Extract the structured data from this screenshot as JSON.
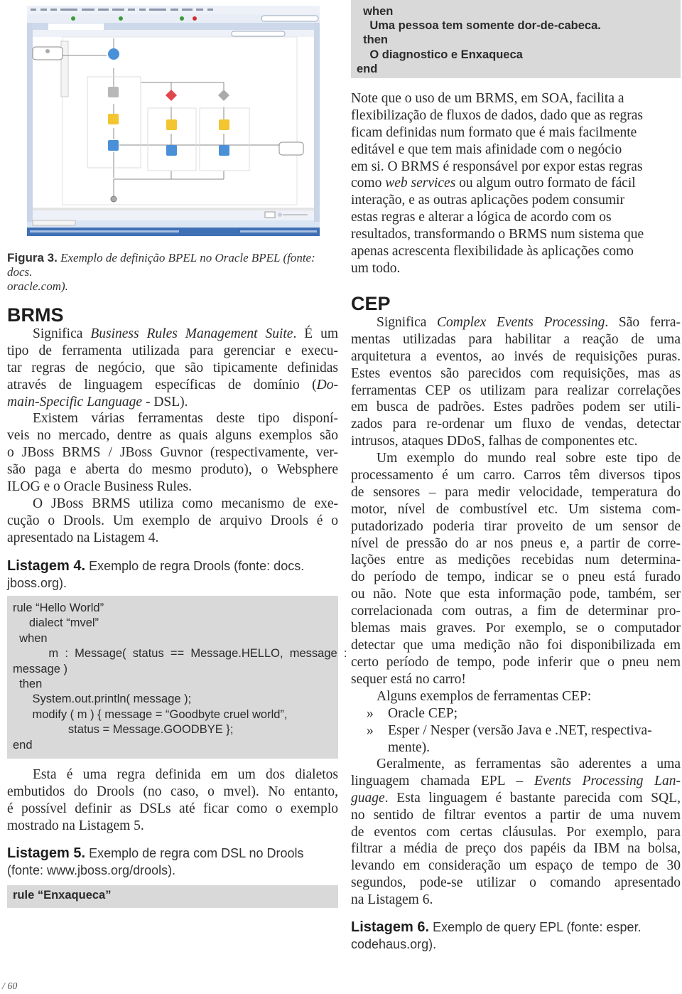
{
  "figure": {
    "caption_label": "Figura 3.",
    "caption_lines": [
      "Exemplo de definição BPEL no Oracle BPEL (fonte: docs.",
      "oracle.com)."
    ]
  },
  "left": {
    "brms_heading": "BRMS",
    "paragraphs": [
      {
        "indent": true,
        "lines": [
          [
            {
              "t": "Significa "
            },
            {
              "t": "Business Rules Management Suite",
              "it": true
            },
            {
              "t": ". É um"
            }
          ],
          [
            {
              "t": "tipo de ferramenta utilizada para gerenciar e execu-"
            }
          ],
          [
            {
              "t": "tar regras de negócio, que são tipicamente definidas"
            }
          ],
          [
            {
              "t": "através de linguagem específicas de domínio ("
            },
            {
              "t": "Do-",
              "it": true
            }
          ],
          [
            {
              "t": "main-Specific Language",
              "it": true
            },
            {
              "t": " - DSL)."
            }
          ]
        ]
      },
      {
        "indent": true,
        "lines": [
          [
            {
              "t": "Existem várias ferramentas deste tipo disponí-"
            }
          ],
          [
            {
              "t": "veis no mercado, dentre as quais alguns exemplos são"
            }
          ],
          [
            {
              "t": "o JBoss BRMS / JBoss Guvnor (respectivamente, ver-"
            }
          ],
          [
            {
              "t": "são paga e aberta do mesmo produto), o Websphere"
            }
          ],
          [
            {
              "t": "ILOG e o Oracle Business Rules."
            }
          ]
        ]
      },
      {
        "indent": true,
        "lines": [
          [
            {
              "t": "O JBoss BRMS utiliza como mecanismo de exe-"
            }
          ],
          [
            {
              "t": "cução o Drools. Um exemplo de arquivo Drools é o"
            }
          ],
          [
            {
              "t": "apresentado na Listagem 4."
            }
          ]
        ]
      }
    ],
    "listing4": {
      "label": "Listagem 4.",
      "caption_lines": [
        "Exemplo de regra Drools (fonte: docs.",
        "jboss.org)."
      ],
      "code": [
        "rule “Hello World”",
        "     dialect “mvel”",
        "  when",
        "           m  :  Message(  status  ==  Message.HELLO,  message  :",
        "message )",
        "  then",
        "      System.out.println( message );",
        "      modify ( m ) { message = “Goodbyte cruel world”,",
        "                 status = Message.GOODBYE };",
        "end"
      ]
    },
    "paragraph_after": {
      "indent": true,
      "lines": [
        [
          {
            "t": "Esta é uma regra definida em um dos dialetos"
          }
        ],
        [
          {
            "t": "embutidos do Drools (no caso, o mvel). No entanto,"
          }
        ],
        [
          {
            "t": "é possível definir as DSLs até ficar como o exemplo"
          }
        ],
        [
          {
            "t": "mostrado na Listagem 5."
          }
        ]
      ]
    },
    "listing5": {
      "label": "Listagem 5.",
      "caption_lines": [
        "Exemplo de regra com DSL no Drools",
        "(fonte: www.jboss.org/drools)."
      ],
      "code": [
        "rule “Enxaqueca”"
      ]
    }
  },
  "right": {
    "code_top": [
      "  when",
      "    Uma pessoa tem somente dor-de-cabeca.",
      "  then",
      "    O diagnostico e Enxaqueca",
      "end"
    ],
    "note_paragraph": {
      "indent": false,
      "ragged": true,
      "lines": [
        [
          {
            "t": "Note que o uso de um BRMS, em SOA, facilita a"
          }
        ],
        [
          {
            "t": "flexibilização de fluxos de dados, dado que as regras"
          }
        ],
        [
          {
            "t": "ficam definidas num formato que é mais facilmente"
          }
        ],
        [
          {
            "t": "editável e que tem mais afinidade com o negócio"
          }
        ],
        [
          {
            "t": "em si. O BRMS é responsável por expor estas regras"
          }
        ],
        [
          {
            "t": "como "
          },
          {
            "t": "web services",
            "it": true
          },
          {
            "t": " ou algum outro formato de fácil"
          }
        ],
        [
          {
            "t": "interação, e as outras aplicações podem consumir"
          }
        ],
        [
          {
            "t": "estas regras e alterar a lógica de acordo com os"
          }
        ],
        [
          {
            "t": "resultados, transformando o BRMS num sistema que"
          }
        ],
        [
          {
            "t": "apenas acrescenta flexibilidade às aplicações como"
          }
        ],
        [
          {
            "t": "um todo."
          }
        ]
      ]
    },
    "cep_heading": "CEP",
    "paragraphs": [
      {
        "indent": true,
        "lines": [
          [
            {
              "t": "Significa "
            },
            {
              "t": "Complex Events Processing",
              "it": true
            },
            {
              "t": ". São ferra-"
            }
          ],
          [
            {
              "t": "mentas utilizadas para habilitar a reação de uma"
            }
          ],
          [
            {
              "t": "arquitetura a eventos, ao invés de requisições puras."
            }
          ],
          [
            {
              "t": "Estes eventos são parecidos com requisições, mas as"
            }
          ],
          [
            {
              "t": "ferramentas CEP os utilizam para realizar correlações"
            }
          ],
          [
            {
              "t": "em busca de padrões. Estes padrões podem ser utili-"
            }
          ],
          [
            {
              "t": "zados para re-ordenar um fluxo de vendas, detectar"
            }
          ],
          [
            {
              "t": "intrusos, ataques DDoS, falhas de componentes etc."
            }
          ]
        ]
      },
      {
        "indent": true,
        "lines": [
          [
            {
              "t": "Um exemplo do mundo real sobre este tipo de"
            }
          ],
          [
            {
              "t": "processamento é um carro. Carros têm diversos tipos"
            }
          ],
          [
            {
              "t": "de sensores – para medir velocidade, temperatura do"
            }
          ],
          [
            {
              "t": "motor, nível de combustível etc. Um sistema com-"
            }
          ],
          [
            {
              "t": "putadorizado poderia tirar proveito de um sensor de"
            }
          ],
          [
            {
              "t": "nível de pressão do ar nos pneus e, a partir de corre-"
            }
          ],
          [
            {
              "t": "lações entre as medições recebidas num determina-"
            }
          ],
          [
            {
              "t": "do período de tempo, indicar se o pneu está furado"
            }
          ],
          [
            {
              "t": "ou não. Note que esta informação pode, também, ser"
            }
          ],
          [
            {
              "t": "correlacionada com outras, a fim de determinar pro-"
            }
          ],
          [
            {
              "t": "blemas mais graves. Por exemplo, se o computador"
            }
          ],
          [
            {
              "t": "detectar que uma medição não foi disponibilizada em"
            }
          ],
          [
            {
              "t": "certo período de tempo, pode inferir que o pneu nem"
            }
          ],
          [
            {
              "t": "sequer está no carro!"
            }
          ]
        ]
      },
      {
        "indent": true,
        "lines": [
          [
            {
              "t": "Alguns exemplos de ferramentas CEP:"
            }
          ]
        ]
      }
    ],
    "bullets": [
      {
        "mark": "»",
        "lines": [
          "Oracle CEP;"
        ]
      },
      {
        "mark": "»",
        "lines": [
          "Esper / Nesper (versão Java e .NET, respectiva-",
          "mente)."
        ]
      }
    ],
    "paragraph_epl": {
      "indent": true,
      "lines": [
        [
          {
            "t": "Geralmente, as ferramentas são aderentes a uma"
          }
        ],
        [
          {
            "t": "linguagem chamada EPL – "
          },
          {
            "t": "Events Processing Lan-",
            "it": true
          }
        ],
        [
          {
            "t": "guage",
            "it": true
          },
          {
            "t": ". Esta linguagem é bastante parecida com SQL,"
          }
        ],
        [
          {
            "t": "no sentido de filtrar eventos a partir de uma nuvem"
          }
        ],
        [
          {
            "t": "de eventos com certas cláusulas. Por exemplo, para"
          }
        ],
        [
          {
            "t": "filtrar a média de preço dos papéis da IBM na bolsa,"
          }
        ],
        [
          {
            "t": "levando em consideração um espaço de tempo de 30"
          }
        ],
        [
          {
            "t": "segundos, pode-se utilizar o comando apresentado"
          }
        ],
        [
          {
            "t": "na Listagem 6."
          }
        ]
      ]
    },
    "listing6": {
      "label": "Listagem 6.",
      "caption_lines": [
        "Exemplo de query EPL (fonte: esper.",
        "codehaus.org)."
      ]
    }
  },
  "footer": {
    "page": "/ 60"
  },
  "colors": {
    "code_bg": "#d9d9d9",
    "ide_frame": "#3f6fb5",
    "bpel_node_blue": "#4a90d9",
    "bpel_node_yellow": "#f2c531",
    "bpel_node_red": "#e0474c"
  }
}
